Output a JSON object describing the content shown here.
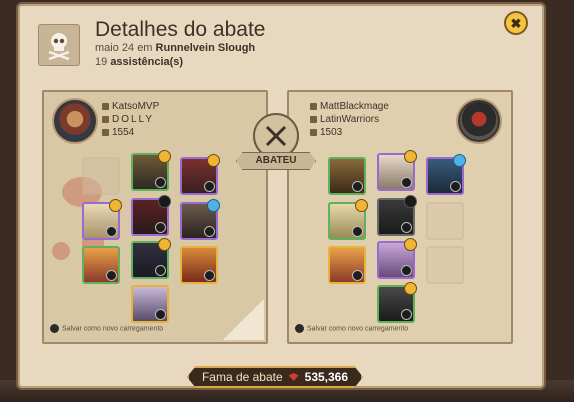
{
  "title": "Detalhes do abate",
  "date_location_prefix": "maio 24 em ",
  "location": "Runnelvein Slough",
  "assist_count": "19",
  "assist_label": "assistência(s)",
  "close_label": "✖",
  "vs_label": "ABATEU",
  "killer": {
    "name": "KatsoMVP",
    "guild": "DOLLY",
    "ip": "1554",
    "save_label": "Salvar como novo carregamento"
  },
  "victim": {
    "name": "MattBlackmage",
    "guild": "LatinWarriors",
    "ip": "1503",
    "save_label": "Salvar como novo carregamento"
  },
  "fame_label": "Fama de abate",
  "fame_value": "535,366",
  "colors": {
    "accent_gold": "#f4c443",
    "panel_bg": "#e8d8bf",
    "tier_green": "#5fb25b",
    "tier_purple": "#9a6ad0",
    "tier_yellow": "#e6b43b"
  }
}
